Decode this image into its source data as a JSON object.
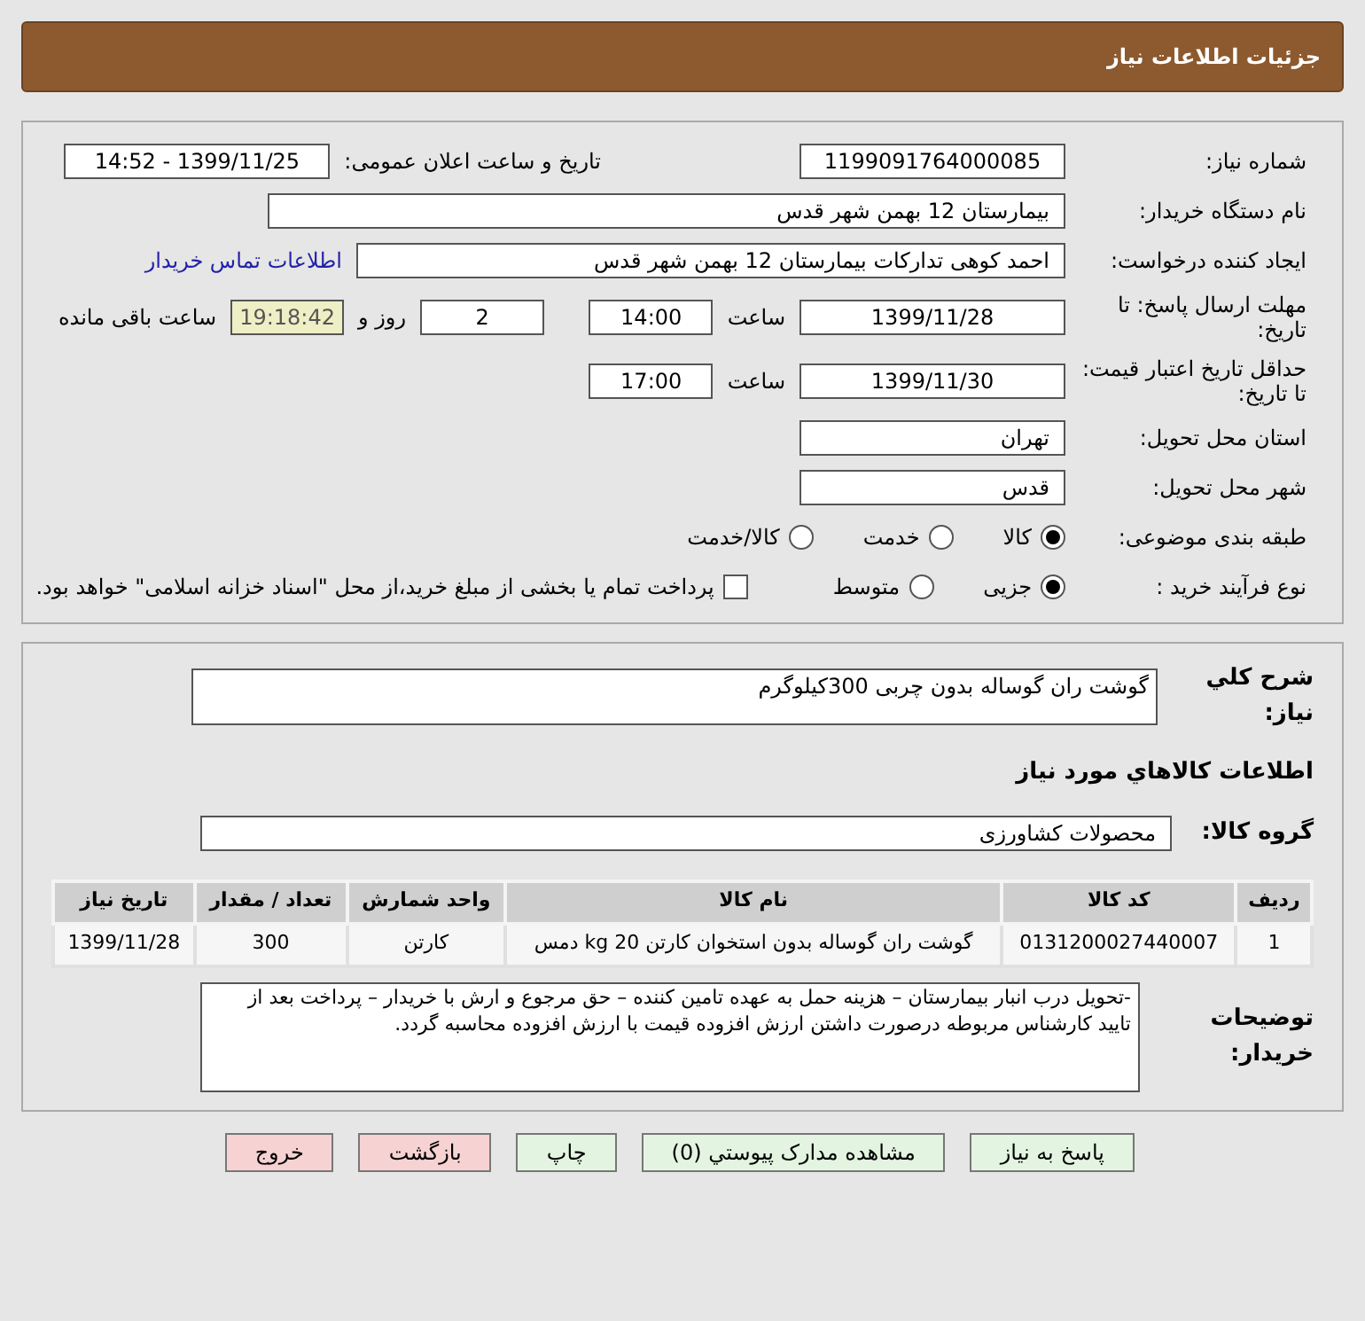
{
  "header": {
    "title": "جزئیات اطلاعات نیاز"
  },
  "need_number": {
    "label": "شماره نیاز:",
    "value": "1199091764000085"
  },
  "announce": {
    "label": "تاریخ و ساعت اعلان عمومی:",
    "value": "1399/11/25 - 14:52"
  },
  "buyer_org": {
    "label": "نام دستگاه خریدار:",
    "value": "بیمارستان 12 بهمن شهر قدس"
  },
  "requester": {
    "label": "ایجاد کننده درخواست:",
    "value": "احمد کوهی تدارکات بیمارستان 12 بهمن شهر قدس",
    "link": "اطلاعات تماس خریدار"
  },
  "deadline": {
    "label": "مهلت ارسال پاسخ: تا تاریخ:",
    "date": "1399/11/28",
    "time_label": "ساعت",
    "time": "14:00",
    "days": "2",
    "days_label": "روز و",
    "remaining": "19:18:42",
    "remaining_label": "ساعت باقی مانده"
  },
  "validity": {
    "label": "حداقل تاریخ اعتبار قیمت: تا تاریخ:",
    "date": "1399/11/30",
    "time_label": "ساعت",
    "time": "17:00"
  },
  "province": {
    "label": "استان محل تحویل:",
    "value": "تهران"
  },
  "city": {
    "label": "شهر محل تحویل:",
    "value": "قدس"
  },
  "category": {
    "label": "طبقه بندی موضوعی:",
    "options": [
      {
        "label": "کالا",
        "selected": true
      },
      {
        "label": "خدمت",
        "selected": false
      },
      {
        "label": "کالا/خدمت",
        "selected": false
      }
    ]
  },
  "process": {
    "label": "نوع فرآیند خرید :",
    "options": [
      {
        "label": "جزیی",
        "selected": true
      },
      {
        "label": "متوسط",
        "selected": false
      }
    ],
    "payment": {
      "label": "پرداخت تمام یا بخشی از مبلغ خرید،از محل \"اسناد خزانه اسلامی\" خواهد بود.",
      "checked": false
    }
  },
  "description": {
    "label": "شرح کلي نياز:",
    "value": "گوشت ران گوساله بدون چربی 300کیلوگرم"
  },
  "goods_title": "اطلاعات کالاهاي مورد نياز",
  "goods_group": {
    "label": "گروه کالا:",
    "value": "محصولات کشاورزی"
  },
  "table": {
    "columns": [
      "ردیف",
      "کد کالا",
      "نام کالا",
      "واحد شمارش",
      "تعداد / مقدار",
      "تاریخ نیاز"
    ],
    "rows": [
      [
        "1",
        "0131200027440007",
        "گوشت ران گوساله بدون استخوان کارتن 20 kg دمس",
        "کارتن",
        "300",
        "1399/11/28"
      ]
    ]
  },
  "notes": {
    "label": "توضیحات خریدار:",
    "value": "-تحویل درب انبار بیمارستان – هزینه حمل به عهده تامین کننده – حق مرجوع و ارش با خریدار – پرداخت بعد از تایید کارشناس مربوطه درصورت داشتن ارزش افزوده قیمت با ارزش افزوده محاسبه گردد."
  },
  "buttons": [
    {
      "label": "پاسخ به نیاز",
      "kind": "primary"
    },
    {
      "label": "مشاهده مدارک پیوستي (0)",
      "kind": "primary"
    },
    {
      "label": "چاپ",
      "kind": "primary"
    },
    {
      "label": "بازگشت",
      "kind": "danger"
    },
    {
      "label": "خروج",
      "kind": "danger"
    }
  ]
}
